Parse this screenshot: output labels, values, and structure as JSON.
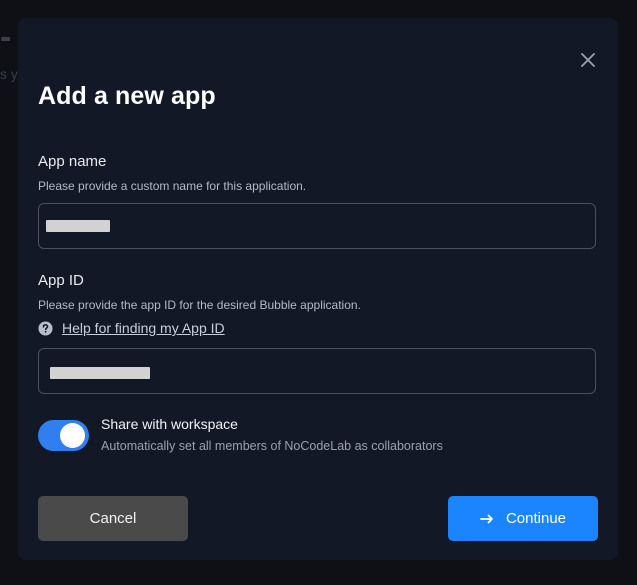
{
  "background": {
    "heading_fragment": "- Y",
    "subtitle_fragment": "s yo"
  },
  "modal": {
    "title": "Add a new app",
    "close_icon": "close-icon"
  },
  "app_name": {
    "label": "App name",
    "help": "Please provide a custom name for this application.",
    "value_redacted": true
  },
  "app_id": {
    "label": "App ID",
    "help": "Please provide the app ID for the desired Bubble application.",
    "help_link": "Help for finding my App ID",
    "help_icon": "question-circle-icon",
    "value_redacted": true
  },
  "share": {
    "title": "Share with workspace",
    "description": "Automatically set all members of NoCodeLab as collaborators",
    "enabled": true
  },
  "buttons": {
    "cancel": "Cancel",
    "continue": "Continue",
    "continue_icon": "arrow-right-icon"
  },
  "colors": {
    "modal_bg": "#131826",
    "accent": "#1a85ff",
    "toggle_on": "#2f7ff0",
    "cancel_bg": "#4a4a4a"
  }
}
